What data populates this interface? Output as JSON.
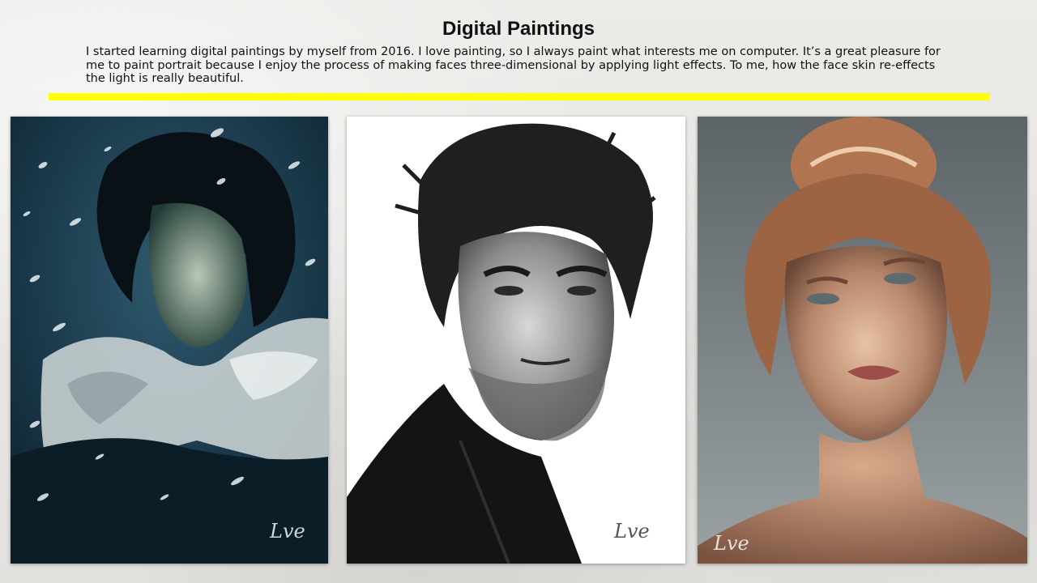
{
  "page": {
    "title": "Digital Paintings",
    "description": "I started learning digital paintings by myself from 2016. I love painting, so I always paint what interests me on computer. It’s a great pleasure for me to paint portrait because I enjoy the process of making faces three-dimensional by applying light effects. To me, how the face skin re-effects the light is really beautiful."
  },
  "colors": {
    "accent_rule": "#ffff00",
    "title_text": "#111111"
  },
  "paintings": [
    {
      "subject": "man with dark curly hair and fur cloak in falling snow",
      "palette": "dark teal / blue",
      "signature": "Lve"
    },
    {
      "subject": "black-and-white portrait of a man with tousled hair and stubble",
      "palette": "greyscale",
      "signature": "Lve"
    },
    {
      "subject": "woman with auburn hair in a loose bun, bare shoulders, soft light",
      "palette": "warm skin / grey background",
      "signature": "Lve"
    }
  ]
}
